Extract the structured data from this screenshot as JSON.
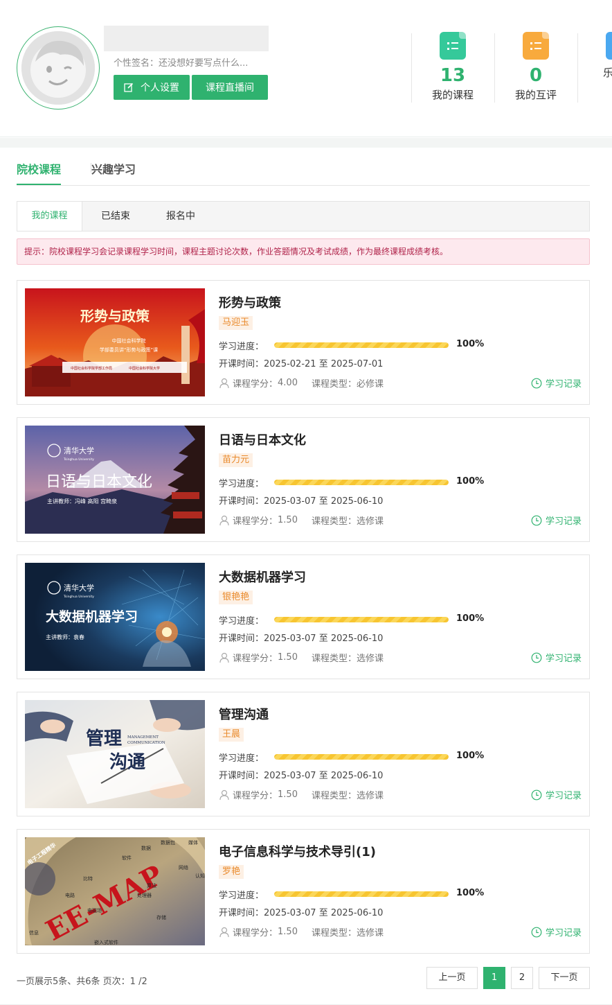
{
  "profile": {
    "signature": "个性签名：还没想好要写点什么...",
    "settings_label": "个人设置",
    "live_label": "课程直播间"
  },
  "stats": [
    {
      "value": "13",
      "label": "我的课程",
      "icon": "list-doc-icon",
      "color": "#35c99a"
    },
    {
      "value": "0",
      "label": "我的互评",
      "icon": "list-doc-icon",
      "color": "#f8aa3d"
    },
    {
      "value": "",
      "label": "乐",
      "icon": "doc-icon",
      "color": "#4aa8f0"
    }
  ],
  "tabs": {
    "top": [
      "院校课程",
      "兴趣学习"
    ],
    "active_top": "院校课程",
    "sub": [
      "我的课程",
      "已结束",
      "报名中"
    ],
    "active_sub": "我的课程"
  },
  "notice": "提示：院校课程学习会记录课程学习时间，课程主题讨论次数，作业答题情况及考试成绩，作为最终课程成绩考核。",
  "labels": {
    "progress": "学习进度：",
    "time_prefix": "开课时间：",
    "credit_prefix": "课程学分：",
    "type_prefix": "课程类型：",
    "record": "学习记录"
  },
  "courses": [
    {
      "title": "形势与政策",
      "teacher": "马迎玉",
      "progress": 1.0,
      "progress_text": "100%",
      "time": "2025-02-21 至 2025-07-01",
      "credit": "4.00",
      "type": "必修课",
      "cover": {
        "headline": "形势与政策",
        "line1": "中国社会科学院",
        "line2": "学部委员讲“形势与政策”课",
        "org1": "中国社会科学院学部工作局",
        "org2": "中国社会科学院大学"
      }
    },
    {
      "title": "日语与日本文化",
      "teacher": "苗力元",
      "progress": 1.0,
      "progress_text": "100%",
      "time": "2025-03-07 至 2025-06-10",
      "credit": "1.50",
      "type": "选修课",
      "cover": {
        "school": "清华大学",
        "school_en": "Tsinghua University",
        "headline": "日语与日本文化",
        "lecturer": "主讲教师：冯峰 高阳 宫畸泉"
      }
    },
    {
      "title": "大数据机器学习",
      "teacher": "银艳艳",
      "progress": 1.0,
      "progress_text": "100%",
      "time": "2025-03-07 至 2025-06-10",
      "credit": "1.50",
      "type": "选修课",
      "cover": {
        "school": "清华大学",
        "school_en": "Tsinghua University",
        "headline": "大数据机器学习",
        "lecturer": "主讲教师：袁春"
      }
    },
    {
      "title": "管理沟通",
      "teacher": "王晨",
      "progress": 1.0,
      "progress_text": "100%",
      "time": "2025-03-07 至 2025-06-10",
      "credit": "1.50",
      "type": "选修课",
      "cover": {
        "headline1": "管理",
        "headline2": "沟通",
        "en1": "MANAGEMENT",
        "en2": "COMMUNICATION"
      }
    },
    {
      "title": "电子信息科学与技术导引(1)",
      "teacher": "罗艳",
      "progress": 1.0,
      "progress_text": "100%",
      "time": "2025-03-07 至 2025-06-10",
      "credit": "1.50",
      "type": "选修课",
      "cover": {
        "headline": "EE-MAP",
        "side": "电子工程精华",
        "words": [
          "数据",
          "数据包",
          "媒体",
          "软件",
          "网络",
          "认知",
          "比特",
          "算法",
          "电路",
          "处理器",
          "电磁场",
          "存储",
          "信息",
          "嵌入式软件"
        ]
      }
    }
  ],
  "pagination": {
    "info": "一页展示5条、共6条 页次：1 /2",
    "prev": "上一页",
    "pages": [
      "1",
      "2"
    ],
    "current": "1",
    "next": "下一页"
  }
}
